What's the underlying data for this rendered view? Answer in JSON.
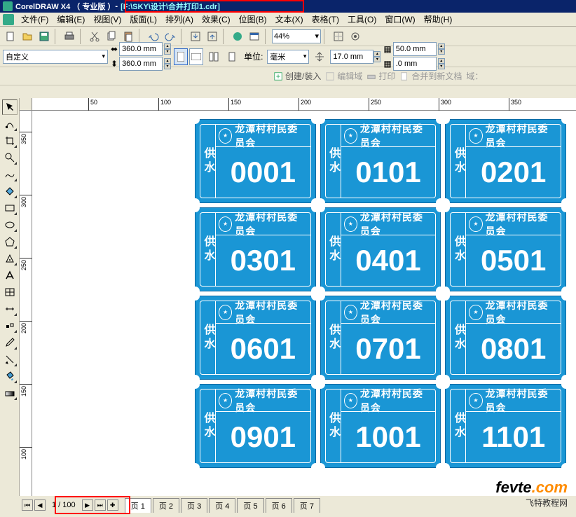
{
  "title": {
    "app": "CorelDRAW X4 （ 专业版 ）",
    "sep": " - ",
    "path": "[F:\\SKY\\设计\\合并打印1.cdr]"
  },
  "menus": [
    "文件(F)",
    "编辑(E)",
    "视图(V)",
    "版面(L)",
    "排列(A)",
    "效果(C)",
    "位图(B)",
    "文本(X)",
    "表格(T)",
    "工具(O)",
    "窗口(W)",
    "帮助(H)"
  ],
  "toolbar": {
    "zoom": "44%"
  },
  "propbar": {
    "preset": "自定义",
    "width": "360.0 mm",
    "height": "360.0 mm",
    "units_label": "单位:",
    "units": "毫米",
    "nudge": "17.0 mm",
    "dup_x": "50.0 mm",
    "dup_y": ".0 mm"
  },
  "createbar": {
    "create": "创建/装入",
    "editfield": "编辑域",
    "print": "打印",
    "merge": "合并到新文档",
    "field": "域："
  },
  "ruler_h": [
    "50",
    "100",
    "150",
    "200",
    "250",
    "300",
    "350"
  ],
  "ruler_v": [
    "350",
    "300",
    "250",
    "200",
    "150",
    "100"
  ],
  "ticket": {
    "side": "供水",
    "org": "龙潭村村民委员会",
    "numbers": [
      "0001",
      "0101",
      "0201",
      "0301",
      "0401",
      "0501",
      "0601",
      "0701",
      "0801",
      "0901",
      "1001",
      "1101"
    ]
  },
  "pager": {
    "current": "1 / 100",
    "tabs": [
      "页 1",
      "页 2",
      "页 3",
      "页 4",
      "页 5",
      "页 6",
      "页 7"
    ]
  },
  "watermark": {
    "brand": "fevte",
    "tld": ".com",
    "sub": "飞特教程网"
  }
}
